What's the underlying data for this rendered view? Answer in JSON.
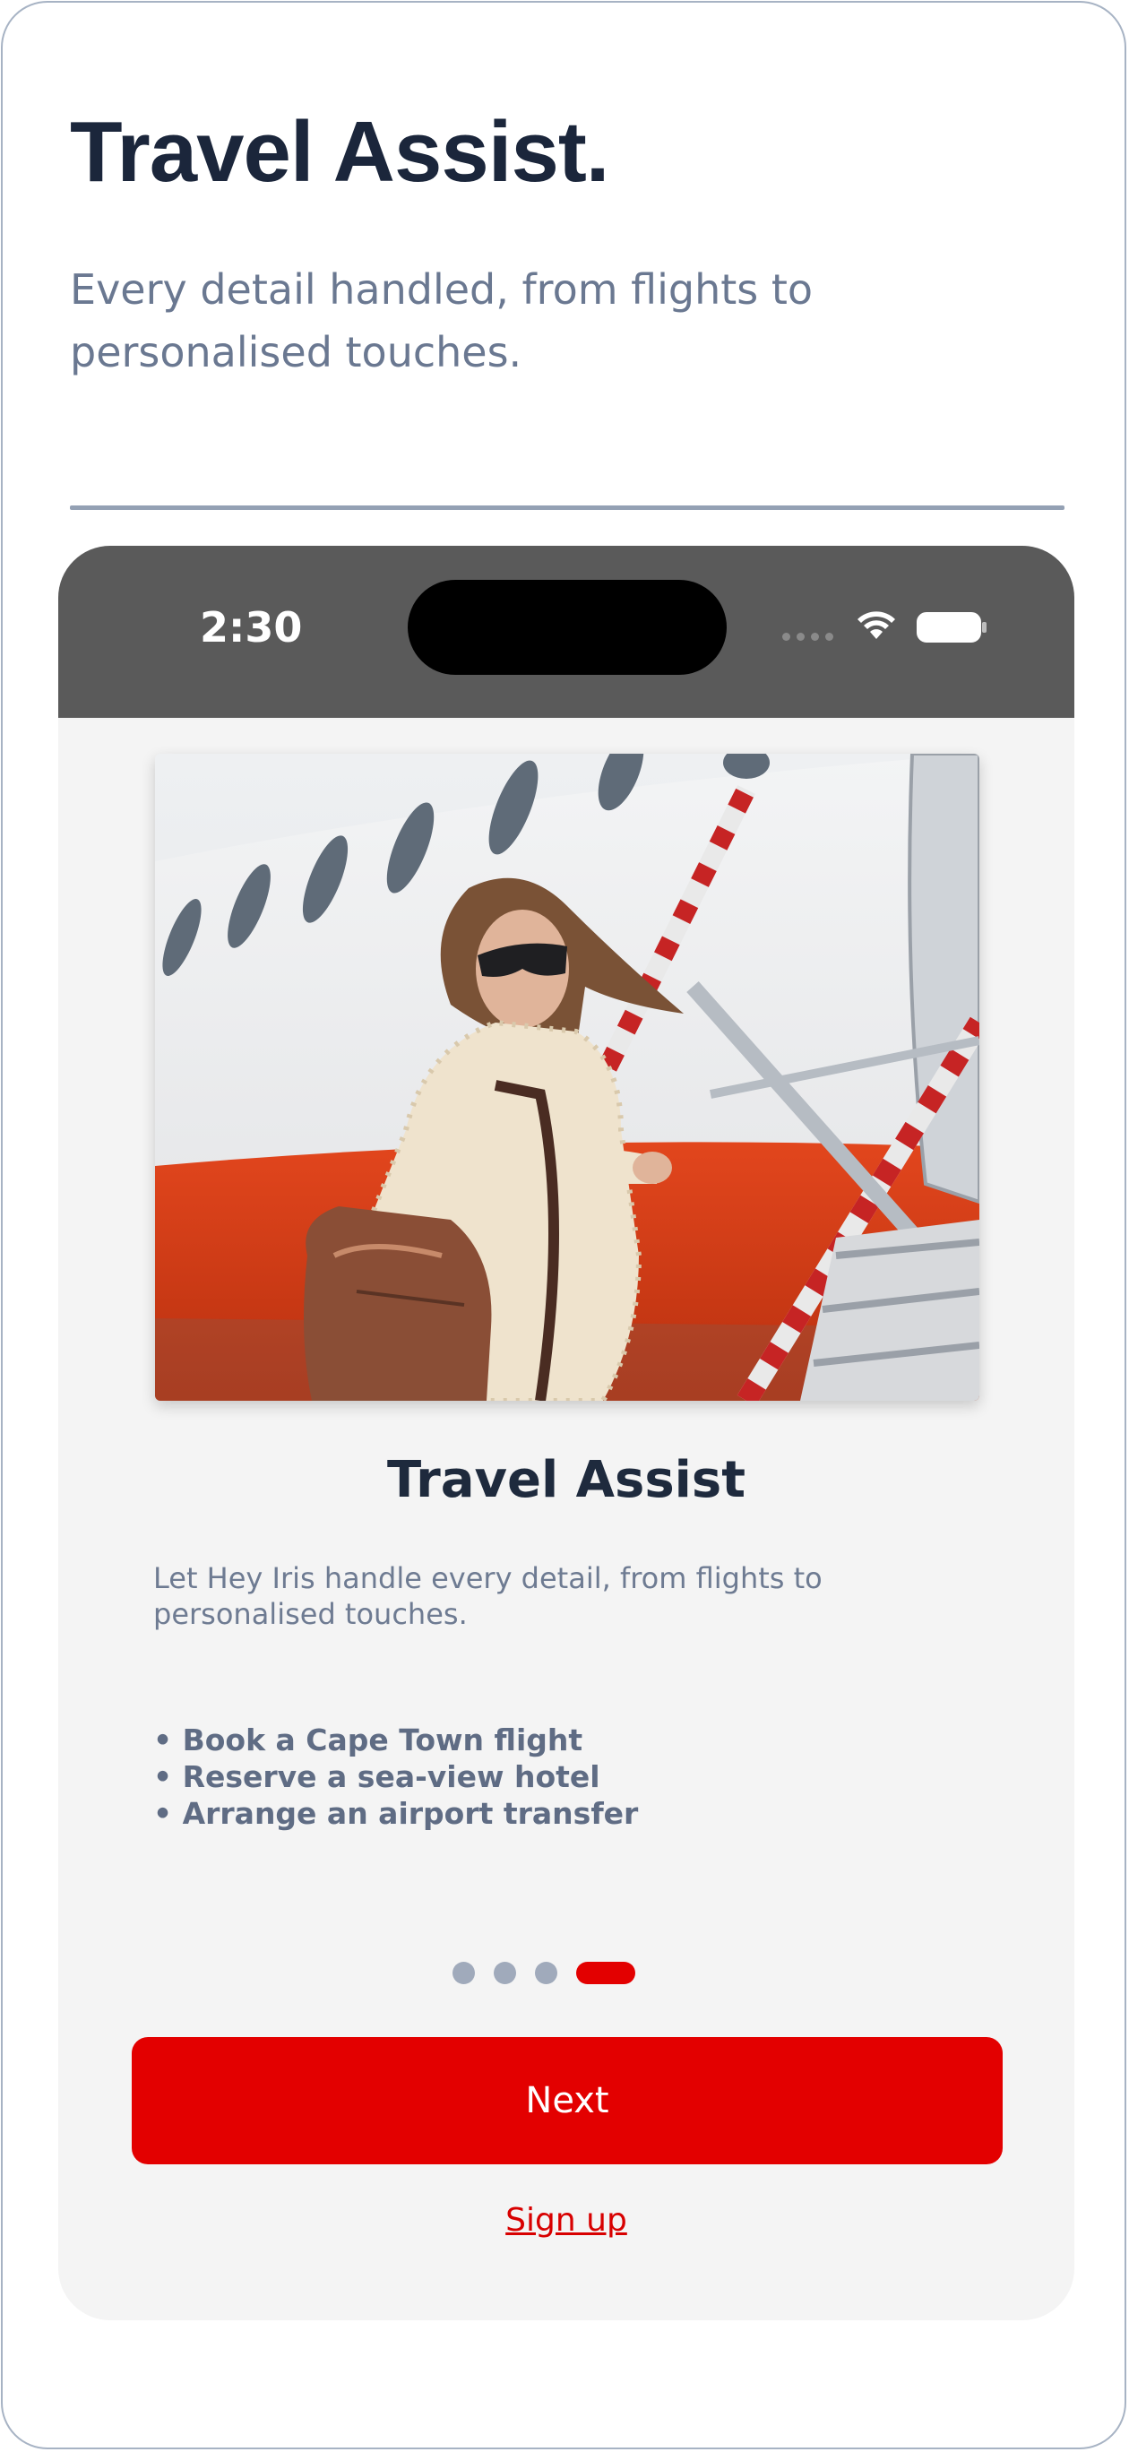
{
  "header": {
    "title": "Travel Assist.",
    "subtitle": "Every detail handled, from flights to personalised touches."
  },
  "phone": {
    "status_bar": {
      "time": "2:30"
    },
    "photo": {
      "icon": "travel-photo"
    },
    "card": {
      "title": "Travel Assist",
      "description": "Let Hey Iris handle every detail, from flights to personalised touches.",
      "bullets": [
        "• Book a Cape Town flight",
        "• Reserve a sea-view hotel",
        "• Arrange an airport transfer"
      ]
    },
    "pager": {
      "total": 4,
      "active_index": 3
    },
    "next_label": "Next",
    "signup_label": "Sign up"
  },
  "colors": {
    "accent": "#e30000",
    "heading": "#1b263b",
    "muted": "#6a7891",
    "status_bar": "#5a5a5a",
    "screen_bg": "#f4f4f4"
  }
}
